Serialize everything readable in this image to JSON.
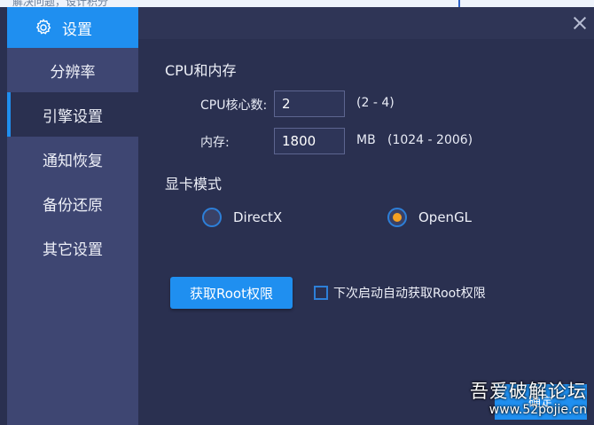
{
  "topbar": {
    "text": "解决问题，设计积分"
  },
  "sidebar": {
    "title": "设置",
    "icon": "gear-icon",
    "items": [
      {
        "label": "分辨率",
        "active": false
      },
      {
        "label": "引擎设置",
        "active": true
      },
      {
        "label": "通知恢复",
        "active": false
      },
      {
        "label": "备份还原",
        "active": false
      },
      {
        "label": "其它设置",
        "active": false
      }
    ]
  },
  "cpu_memory": {
    "section_title": "CPU和内存",
    "cpu_label": "CPU核心数:",
    "cpu_value": "2",
    "cpu_range": "(2 - 4)",
    "mem_label": "内存:",
    "mem_value": "1800",
    "mem_unit": "MB",
    "mem_range": "(1024 - 2006)"
  },
  "gpu": {
    "section_title": "显卡模式",
    "options": [
      {
        "label": "DirectX",
        "selected": false
      },
      {
        "label": "OpenGL",
        "selected": true
      }
    ]
  },
  "root": {
    "button_label": "获取Root权限",
    "checkbox_label": "下次启动自动获取Root权限",
    "checkbox_checked": false
  },
  "footer": {
    "ok_label": "确定",
    "watermark_line1": "吾爱破解论坛",
    "watermark_line2": "www.52pojie.cn"
  },
  "colors": {
    "accent": "#1f8ff0",
    "sidebar_bg": "#3e4672",
    "content_bg": "#2a3050",
    "radio_selected": "#f5a021"
  }
}
